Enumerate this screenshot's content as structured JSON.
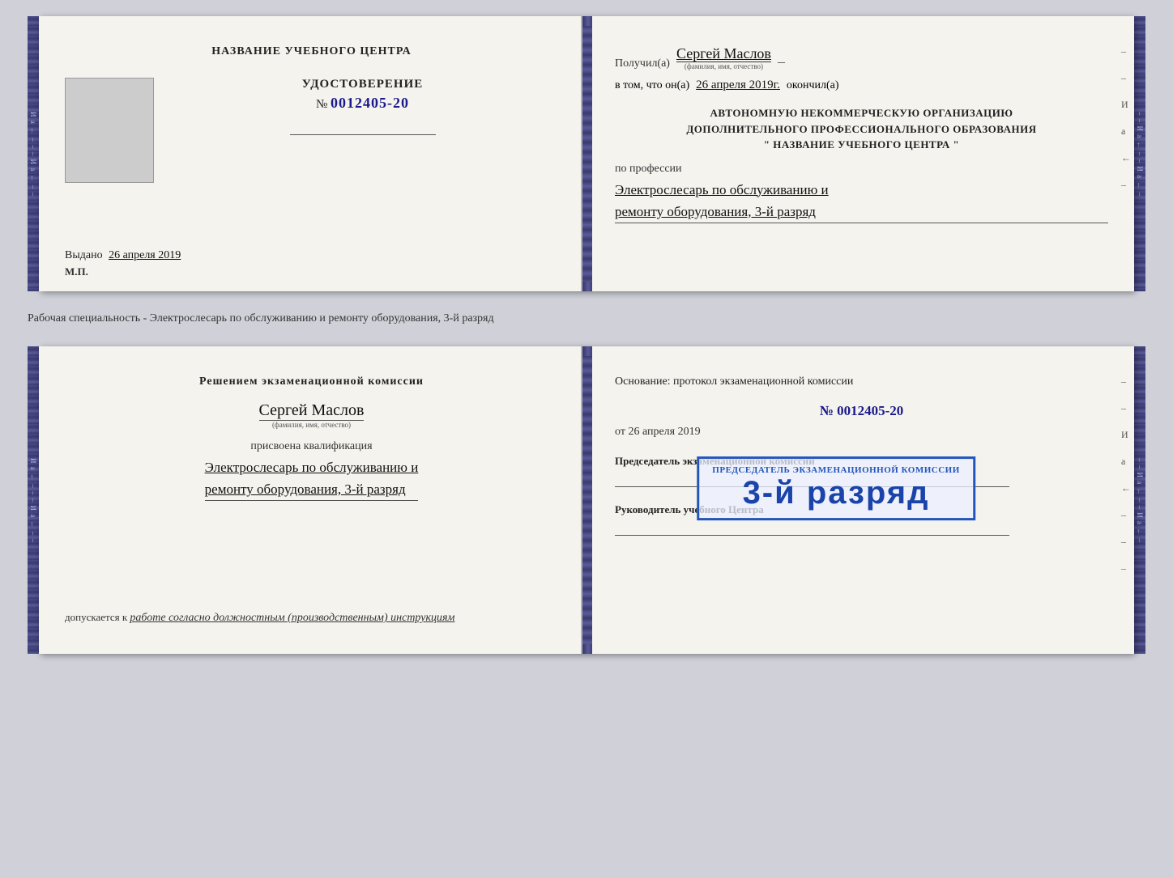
{
  "top_card": {
    "left": {
      "title": "НАЗВАНИЕ УЧЕБНОГО ЦЕНТРА",
      "cert_label": "УДОСТОВЕРЕНИЕ",
      "cert_number_prefix": "№",
      "cert_number": "0012405-20",
      "issued_label": "Выдано",
      "issued_date": "26 апреля 2019",
      "mp_label": "М.П."
    },
    "right": {
      "received_label": "Получил(а)",
      "recipient_name": "Сергей Маслов",
      "fio_hint": "(фамилия, имя, отчество)",
      "dash": "–",
      "date_prefix": "в том, что он(а)",
      "date_value": "26 апреля 2019г.",
      "finished_label": "окончил(а)",
      "org_line1": "АВТОНОМНУЮ НЕКОММЕРЧЕСКУЮ ОРГАНИЗАЦИЮ",
      "org_line2": "ДОПОЛНИТЕЛЬНОГО ПРОФЕССИОНАЛЬНОГО ОБРАЗОВАНИЯ",
      "org_line3": "\"   НАЗВАНИЕ УЧЕБНОГО ЦЕНТРА   \"",
      "profession_prefix": "по профессии",
      "profession_line1": "Электрослесарь по обслуживанию и",
      "profession_line2": "ремонту оборудования, 3-й разряд"
    }
  },
  "middle_text": "Рабочая специальность - Электрослесарь по обслуживанию и ремонту оборудования, 3-й разряд",
  "bottom_card": {
    "left": {
      "decision_title": "Решением экзаменационной комиссии",
      "person_name": "Сергей Маслов",
      "fio_hint": "(фамилия, имя, отчество)",
      "qual_prefix": "присвоена квалификация",
      "qual_line1": "Электрослесарь по обслуживанию и",
      "qual_line2": "ремонту оборудования, 3-й разряд",
      "допускается_prefix": "допускается к",
      "допускается_value": "работе согласно должностным (производственным) инструкциям"
    },
    "right": {
      "basis_label": "Основание: протокол экзаменационной комиссии",
      "basis_number_prefix": "№",
      "basis_number": "0012405-20",
      "basis_date_prefix": "от",
      "basis_date": "26 апреля 2019",
      "chairman_label": "Председатель экзаменационной комиссии",
      "руководитель_label": "Руководитель учебного Центра"
    },
    "stamp": {
      "small_text": "Председатель экзаменационной комиссии",
      "large_text": "3-й разряд"
    }
  },
  "side_chars": [
    "И",
    "а",
    "←",
    "–",
    "–",
    "–",
    "И",
    "а",
    "←",
    "–",
    "–"
  ]
}
